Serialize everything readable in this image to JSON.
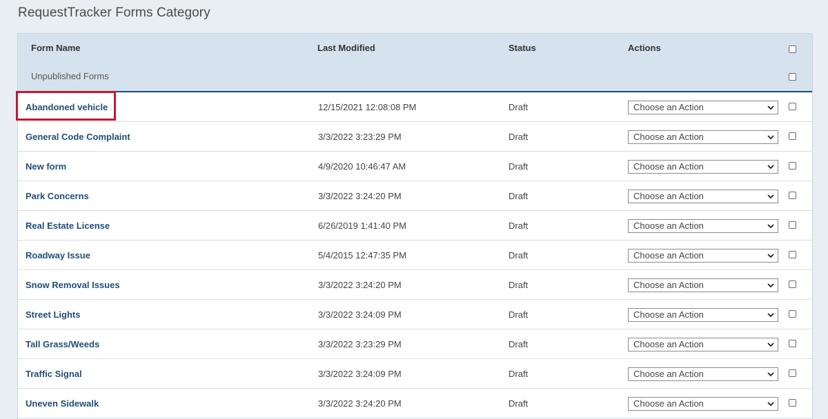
{
  "page": {
    "title": "RequestTracker Forms Category"
  },
  "table": {
    "headers": {
      "form_name": "Form Name",
      "last_modified": "Last Modified",
      "status": "Status",
      "actions": "Actions"
    },
    "section_label": "Unpublished Forms",
    "action_placeholder": "Choose an Action",
    "rows": [
      {
        "name": "Abandoned vehicle",
        "modified": "12/15/2021 12:08:08 PM",
        "status": "Draft"
      },
      {
        "name": "General Code Complaint",
        "modified": "3/3/2022 3:23:29 PM",
        "status": "Draft"
      },
      {
        "name": "New form",
        "modified": "4/9/2020 10:46:47 AM",
        "status": "Draft"
      },
      {
        "name": "Park Concerns",
        "modified": "3/3/2022 3:24:20 PM",
        "status": "Draft"
      },
      {
        "name": "Real Estate License",
        "modified": "6/26/2019 1:41:40 PM",
        "status": "Draft"
      },
      {
        "name": "Roadway Issue",
        "modified": "5/4/2015 12:47:35 PM",
        "status": "Draft"
      },
      {
        "name": "Snow Removal Issues",
        "modified": "3/3/2022 3:24:20 PM",
        "status": "Draft"
      },
      {
        "name": "Street Lights",
        "modified": "3/3/2022 3:24:09 PM",
        "status": "Draft"
      },
      {
        "name": "Tall Grass/Weeds",
        "modified": "3/3/2022 3:23:29 PM",
        "status": "Draft"
      },
      {
        "name": "Traffic Signal",
        "modified": "3/3/2022 3:24:09 PM",
        "status": "Draft"
      },
      {
        "name": "Uneven Sidewalk",
        "modified": "3/3/2022 3:24:20 PM",
        "status": "Draft"
      }
    ]
  },
  "colors": {
    "link": "#1f4e79",
    "header_bg": "#d6e2ee",
    "highlight": "#c3172d"
  }
}
